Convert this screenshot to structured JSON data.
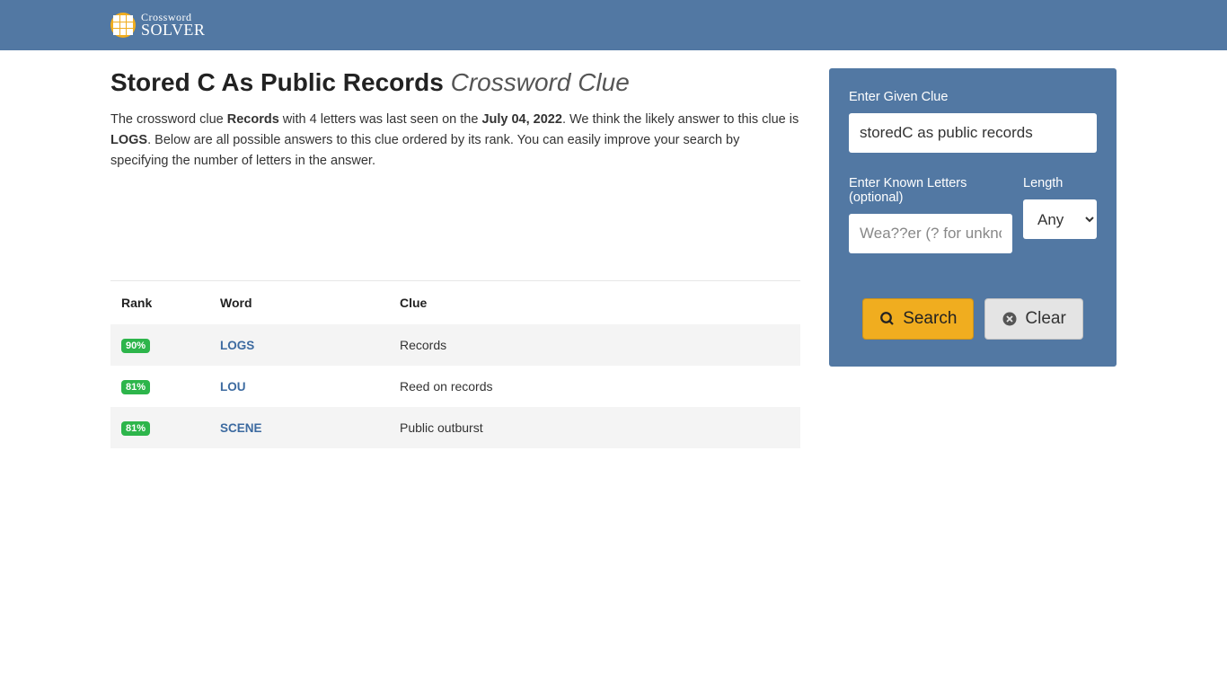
{
  "brand": {
    "line1": "Crossword",
    "line2": "SOLVER"
  },
  "page": {
    "title_main": "Stored C As Public Records",
    "title_suffix": "Crossword Clue",
    "intro_prefix": "The crossword clue ",
    "intro_clue": "Records",
    "intro_mid1": " with 4 letters was last seen on the ",
    "intro_date": "July 04, 2022",
    "intro_mid2": ". We think the likely answer to this clue is ",
    "intro_answer": "LOGS",
    "intro_suffix": ". Below are all possible answers to this clue ordered by its rank. You can easily improve your search by specifying the number of letters in the answer."
  },
  "table": {
    "headers": {
      "rank": "Rank",
      "word": "Word",
      "clue": "Clue"
    },
    "rows": [
      {
        "rank": "90%",
        "word": "LOGS",
        "clue": "Records"
      },
      {
        "rank": "81%",
        "word": "LOU",
        "clue": "Reed on records"
      },
      {
        "rank": "81%",
        "word": "SCENE",
        "clue": "Public outburst"
      }
    ]
  },
  "search": {
    "clue_label": "Enter Given Clue",
    "clue_value": "storedC as public records",
    "letters_label": "Enter Known Letters (optional)",
    "letters_placeholder": "Wea??er (? for unknown)",
    "length_label": "Length",
    "length_value": "Any",
    "search_btn": "Search",
    "clear_btn": "Clear"
  }
}
